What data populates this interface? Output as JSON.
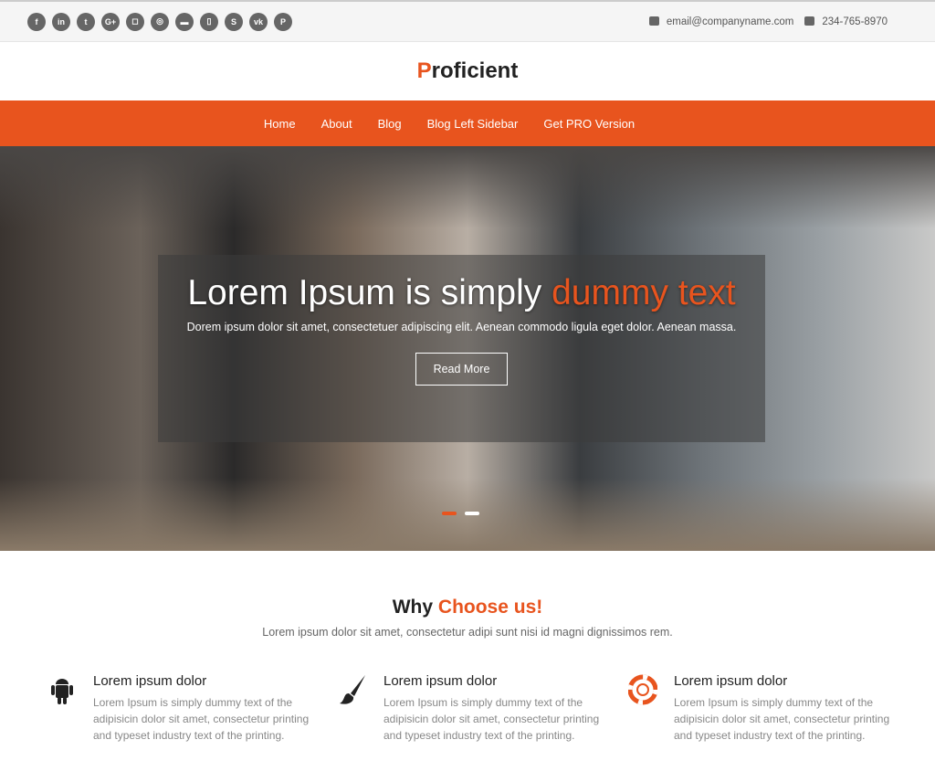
{
  "topbar": {
    "socials": [
      {
        "icon": "facebook-icon",
        "glyph": "f"
      },
      {
        "icon": "linkedin-icon",
        "glyph": "in"
      },
      {
        "icon": "twitter-icon",
        "glyph": "t"
      },
      {
        "icon": "google-plus-icon",
        "glyph": "G+"
      },
      {
        "icon": "instagram-icon",
        "glyph": "◻"
      },
      {
        "icon": "dribbble-icon",
        "glyph": "◎"
      },
      {
        "icon": "github-icon",
        "glyph": "▬"
      },
      {
        "icon": "foursquare-icon",
        "glyph": "▯"
      },
      {
        "icon": "skype-icon",
        "glyph": "S"
      },
      {
        "icon": "vk-icon",
        "glyph": "vk"
      },
      {
        "icon": "pinterest-icon",
        "glyph": "P"
      }
    ],
    "email": "email@companyname.com",
    "phone": "234-765-8970"
  },
  "brand": {
    "first": "P",
    "rest": "roficient"
  },
  "nav": [
    "Home",
    "About",
    "Blog",
    "Blog Left Sidebar",
    "Get PRO Version"
  ],
  "hero": {
    "title_a": "Lorem Ipsum is simply ",
    "title_b": "dummy text",
    "text": "Dorem ipsum dolor sit amet, consectetuer adipiscing elit. Aenean commodo ligula eget dolor. Aenean massa.",
    "button": "Read More",
    "slides": 2,
    "active_slide": 1
  },
  "why": {
    "title_a": "Why ",
    "title_b": "Choose us!",
    "subtitle": "Lorem ipsum dolor sit amet, consectetur adipi sunt nisi id magni dignissimos rem."
  },
  "features": [
    {
      "icon": "android-icon",
      "title": "Lorem ipsum dolor",
      "text": "Lorem Ipsum is simply dummy text of the adipisicin dolor sit amet, consectetur printing and typeset industry text of the printing."
    },
    {
      "icon": "paintbrush-icon",
      "title": "Lorem ipsum dolor",
      "text": "Lorem Ipsum is simply dummy text of the adipisicin dolor sit amet, consectetur printing and typeset industry text of the printing."
    },
    {
      "icon": "life-ring-icon",
      "title": "Lorem ipsum dolor",
      "text": "Lorem Ipsum is simply dummy text of the adipisicin dolor sit amet, consectetur printing and typeset industry text of the printing."
    }
  ],
  "colors": {
    "accent": "#e8541e"
  }
}
